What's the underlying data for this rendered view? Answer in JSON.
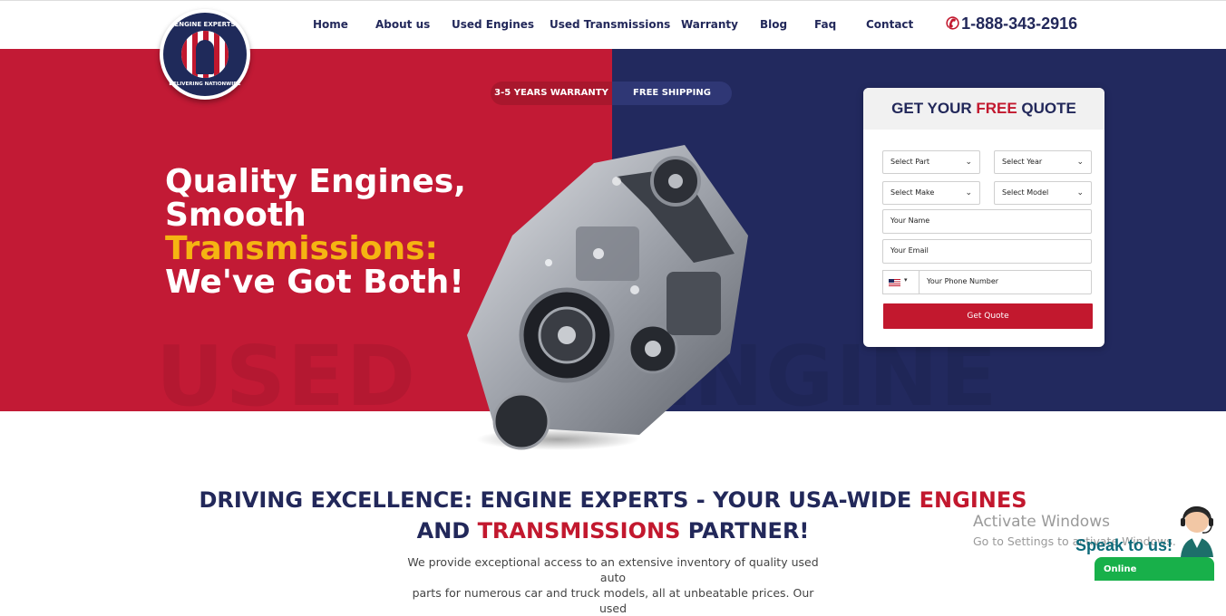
{
  "brand": {
    "logo_top_text": "ENGINE EXPERTS",
    "logo_bottom_text": "DELIVERING NATIONWIDE"
  },
  "nav": {
    "items": [
      "Home",
      "About us",
      "Used Engines",
      "Used Transmissions",
      "Warranty",
      "Blog",
      "Faq",
      "Contact"
    ],
    "phone": "1-888-343-2916"
  },
  "hero": {
    "badge_warranty": "3-5 YEARS WARRANTY",
    "badge_shipping": "FREE SHIPPING",
    "headline_line1": "Quality Engines,",
    "headline_line2": "Smooth",
    "headline_line3": "Transmissions:",
    "headline_line4": "We've Got Both!",
    "bg_word_left": "USED",
    "bg_word_right": "ENGINE"
  },
  "quote_form": {
    "title_pre": "GET YOUR ",
    "title_highlight": "FREE",
    "title_post": " QUOTE",
    "select_part": "Select Part",
    "select_year": "Select Year",
    "select_make": "Select Make",
    "select_model": "Select Model",
    "name_placeholder": "Your Name",
    "email_placeholder": "Your Email",
    "phone_placeholder": "Your Phone Number",
    "submit_label": "Get Quote"
  },
  "intro": {
    "title_part1": "DRIVING EXCELLENCE: ENGINE EXPERTS - YOUR USA-WIDE ",
    "title_engines": "ENGINES",
    "title_part2": "AND ",
    "title_transmissions": "TRANSMISSIONS",
    "title_part3": " PARTNER!",
    "paragraph_line1": "We provide exceptional access to an extensive inventory of quality used auto",
    "paragraph_line2": "parts for numerous car and truck models, all at unbeatable prices. Our used"
  },
  "overlay": {
    "activate_title": "Activate Windows",
    "activate_sub": "Go to Settings to activate Windows.",
    "chat_speak": "Speak to us!",
    "chat_status": "Online"
  },
  "colors": {
    "red": "#c21a35",
    "navy": "#22295e",
    "yellow": "#f5b412",
    "green": "#18b04a"
  }
}
